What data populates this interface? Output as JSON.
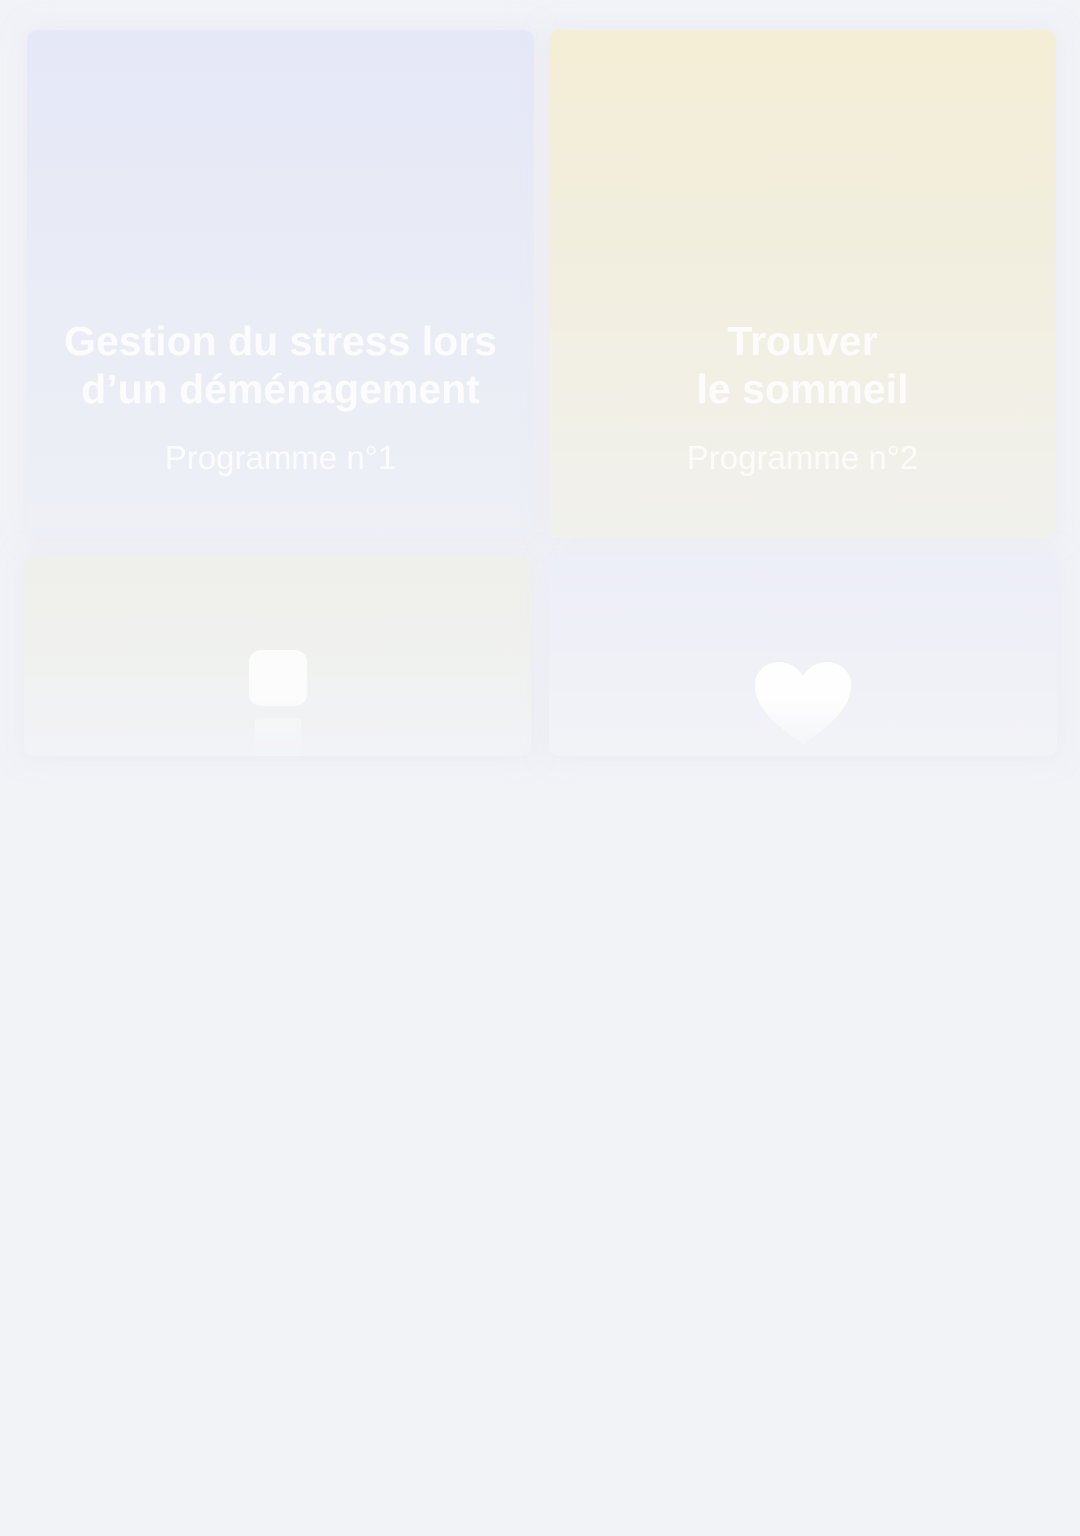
{
  "programs": [
    {
      "title": "Gestion du stress lors\nd’un déménagement",
      "subtitle": "Programme n°1"
    },
    {
      "title": "Trouver\nle sommeil",
      "subtitle": "Programme n°2"
    },
    {
      "icon": "bottle-icon"
    },
    {
      "icon": "heart-icon"
    }
  ],
  "colors": {
    "background": "#f2f3f7",
    "card_1": "#e5e8f7",
    "card_2": "#f4eed6",
    "card_3": "#eff0eb",
    "card_4": "#eceef8",
    "text": "#ffffff"
  }
}
